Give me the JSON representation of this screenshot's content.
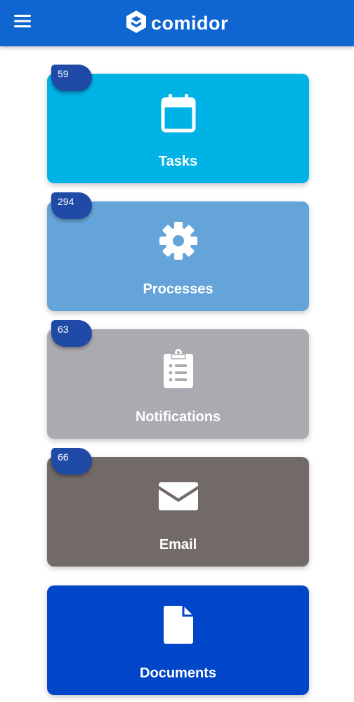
{
  "header": {
    "brand_name": "comidor",
    "menu_icon": "hamburger-menu-icon",
    "logo_icon": "comidor-logo-icon",
    "background": "#0f66d0"
  },
  "tiles": [
    {
      "label": "Tasks",
      "badge": "59",
      "icon": "calendar-icon",
      "color": "#00b3e6"
    },
    {
      "label": "Processes",
      "badge": "294",
      "icon": "gear-icon",
      "color": "#64a4d8"
    },
    {
      "label": "Notifications",
      "badge": "63",
      "icon": "clipboard-list-icon",
      "color": "#abaab0"
    },
    {
      "label": "Email",
      "badge": "66",
      "icon": "envelope-icon",
      "color": "#726a66"
    },
    {
      "label": "Documents",
      "badge": "",
      "icon": "document-icon",
      "color": "#0145c8"
    }
  ],
  "colors": {
    "badge": "#1f4aa5"
  }
}
